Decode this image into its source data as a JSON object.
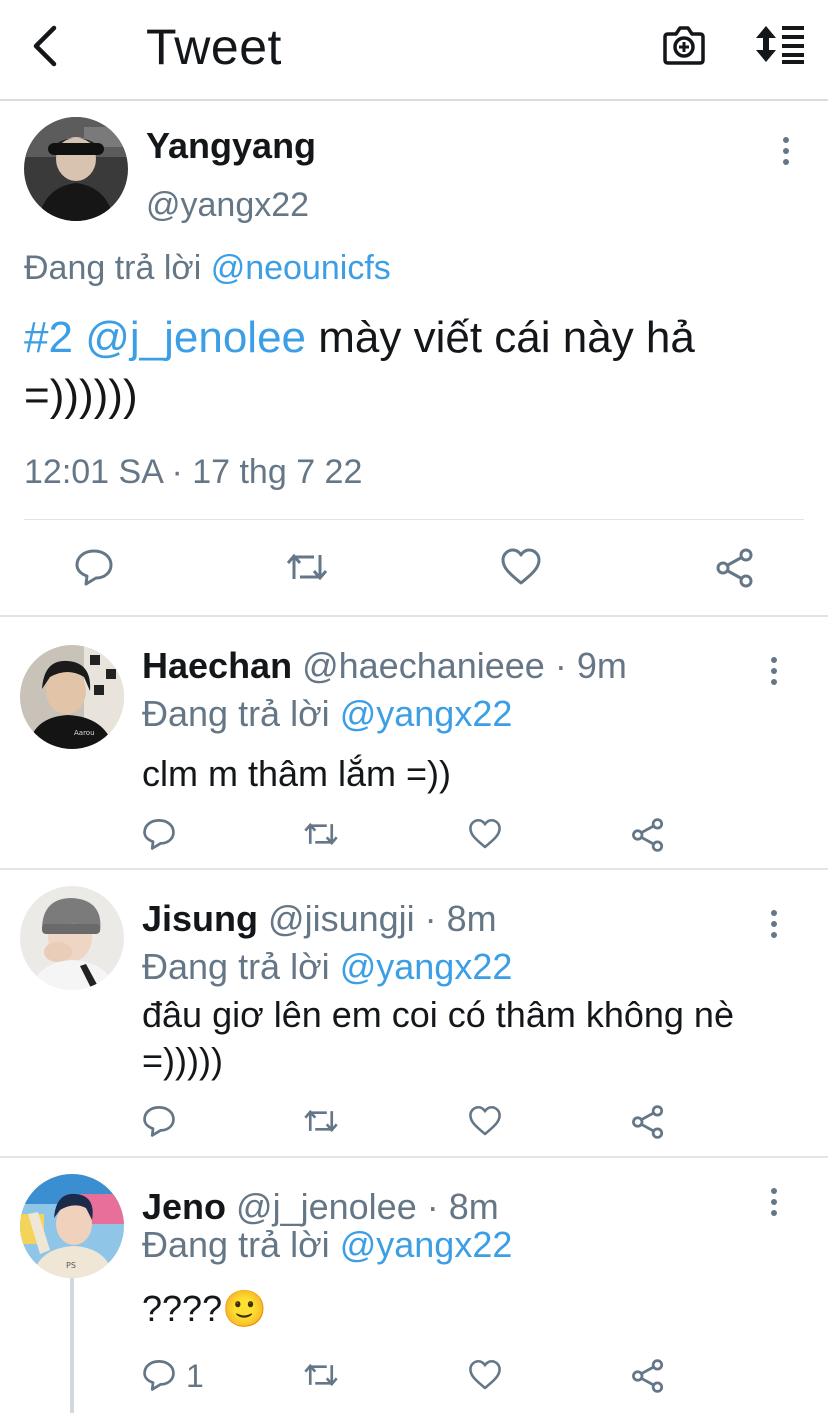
{
  "header": {
    "title": "Tweet",
    "back_icon": "chevron-left-icon",
    "camera_icon": "camera-add-icon",
    "sort_icon": "sort-icon"
  },
  "main_tweet": {
    "name": "Yangyang",
    "handle": "@yangx22",
    "replying_prefix": "Đang trả lời",
    "replying_to": "@neounicfs",
    "text_hashtag": "#2",
    "text_mention": "@j_jenolee",
    "text_body": " mày viết cái này hả =))))))",
    "timestamp": "12:01 SA · 17 thg 7 22"
  },
  "replies": [
    {
      "name": "Haechan",
      "handle": "@haechanieee",
      "time": "· 9m",
      "replying_prefix": "Đang trả lời",
      "replying_to": "@yangx22",
      "text": "clm m thâm lắm =))",
      "reply_count": ""
    },
    {
      "name": "Jisung",
      "handle": "@jisungji",
      "time": "· 8m",
      "replying_prefix": "Đang trả lời",
      "replying_to": "@yangx22",
      "text": "đâu giơ lên em coi có thâm không nè =)))))",
      "reply_count": ""
    },
    {
      "name": "Jeno",
      "handle": "@j_jenolee",
      "time": "· 8m",
      "replying_prefix": "Đang trả lời",
      "replying_to": "@yangx22",
      "text": "????",
      "emoji": "🙂",
      "reply_count": "1"
    }
  ],
  "colors": {
    "link": "#3c9fe6",
    "muted": "#657786",
    "text": "#14171a",
    "divider": "#e1e4e8"
  }
}
